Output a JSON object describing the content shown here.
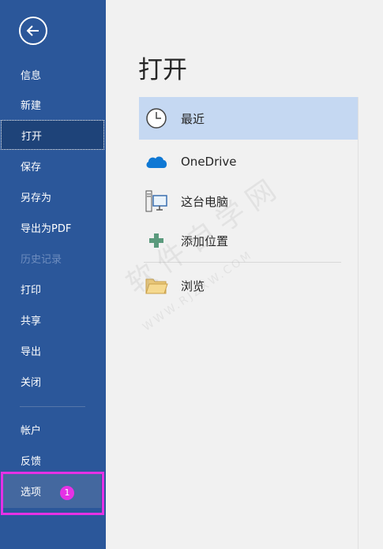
{
  "sidebar": {
    "items": [
      {
        "label": "信息"
      },
      {
        "label": "新建"
      },
      {
        "label": "打开"
      },
      {
        "label": "保存"
      },
      {
        "label": "另存为"
      },
      {
        "label": "导出为PDF"
      },
      {
        "label": "历史记录"
      },
      {
        "label": "打印"
      },
      {
        "label": "共享"
      },
      {
        "label": "导出"
      },
      {
        "label": "关闭"
      },
      {
        "label": "帐户"
      },
      {
        "label": "反馈"
      },
      {
        "label": "选项"
      }
    ],
    "active_item": "打开",
    "disabled_item": "历史记录",
    "step_badge": "1"
  },
  "main": {
    "title": "打开",
    "locations": [
      {
        "label": "最近",
        "icon": "clock-icon"
      },
      {
        "label": "OneDrive",
        "icon": "onedrive-cloud-icon"
      },
      {
        "label": "这台电脑",
        "icon": "computer-icon"
      },
      {
        "label": "添加位置",
        "icon": "plus-icon"
      },
      {
        "label": "浏览",
        "icon": "folder-icon"
      }
    ]
  },
  "watermark": {
    "text": "软件自学网",
    "url": "WWW.RJZXW.COM"
  },
  "colors": {
    "sidebar": "#2b579a",
    "active": "#1e4379",
    "selected": "#c5d8f2",
    "highlight": "#e531e5",
    "onedrive": "#0f78d4",
    "plus": "#5b9a7d"
  }
}
